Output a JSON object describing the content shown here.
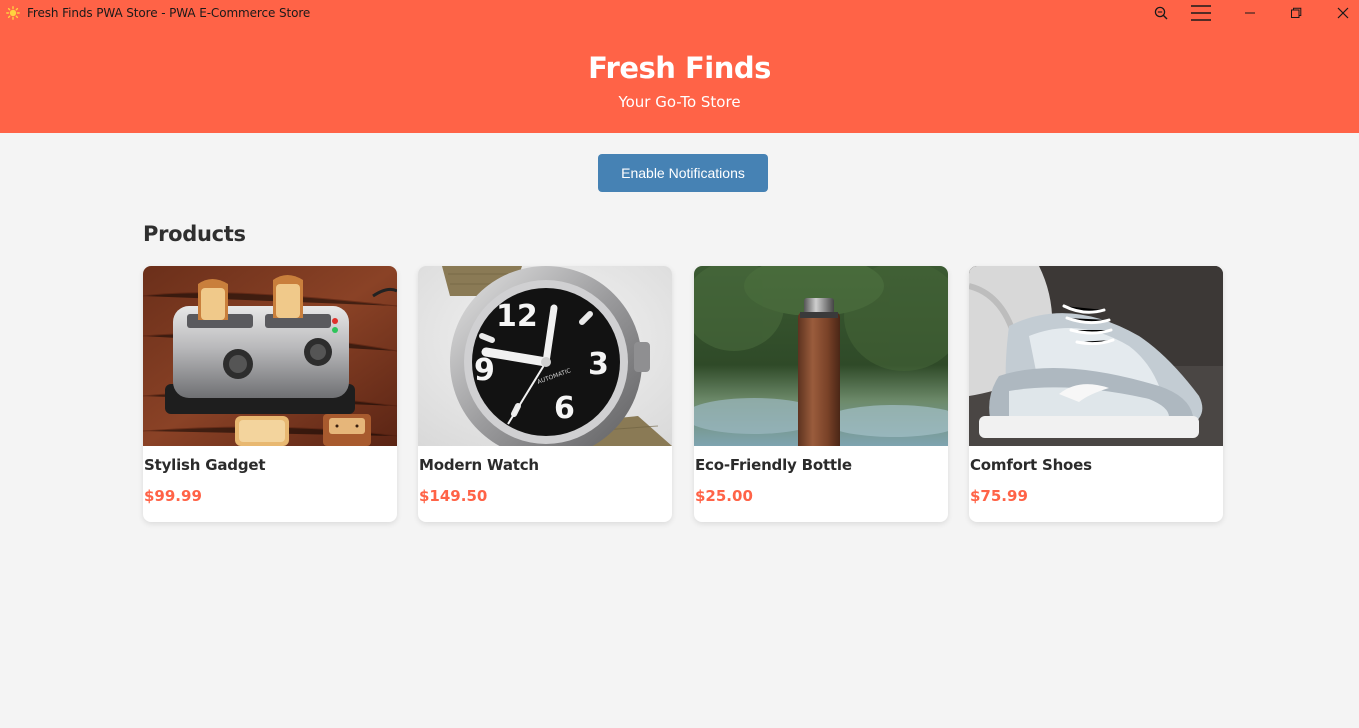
{
  "window": {
    "title": "Fresh Finds PWA Store - PWA E-Commerce Store",
    "icon": "sun-icon",
    "controls": [
      "zoom-icon",
      "menu-icon",
      "minimize-icon",
      "maximize-icon",
      "close-icon"
    ]
  },
  "header": {
    "brand": "Fresh Finds",
    "tagline": "Your Go-To Store",
    "background": "#ff6347"
  },
  "actions": {
    "enable_notifications_label": "Enable Notifications",
    "button_color": "#4682b4"
  },
  "products_section": {
    "title": "Products",
    "price_color": "#ff6347",
    "items": [
      {
        "name": "Stylish Gadget",
        "price": "$99.99",
        "image": "toaster-usb-gadget-photo"
      },
      {
        "name": "Modern Watch",
        "price": "$149.50",
        "image": "wristwatch-photo"
      },
      {
        "name": "Eco-Friendly Bottle",
        "price": "$25.00",
        "image": "water-bottle-photo"
      },
      {
        "name": "Comfort Shoes",
        "price": "$75.99",
        "image": "sneakers-photo"
      }
    ]
  }
}
